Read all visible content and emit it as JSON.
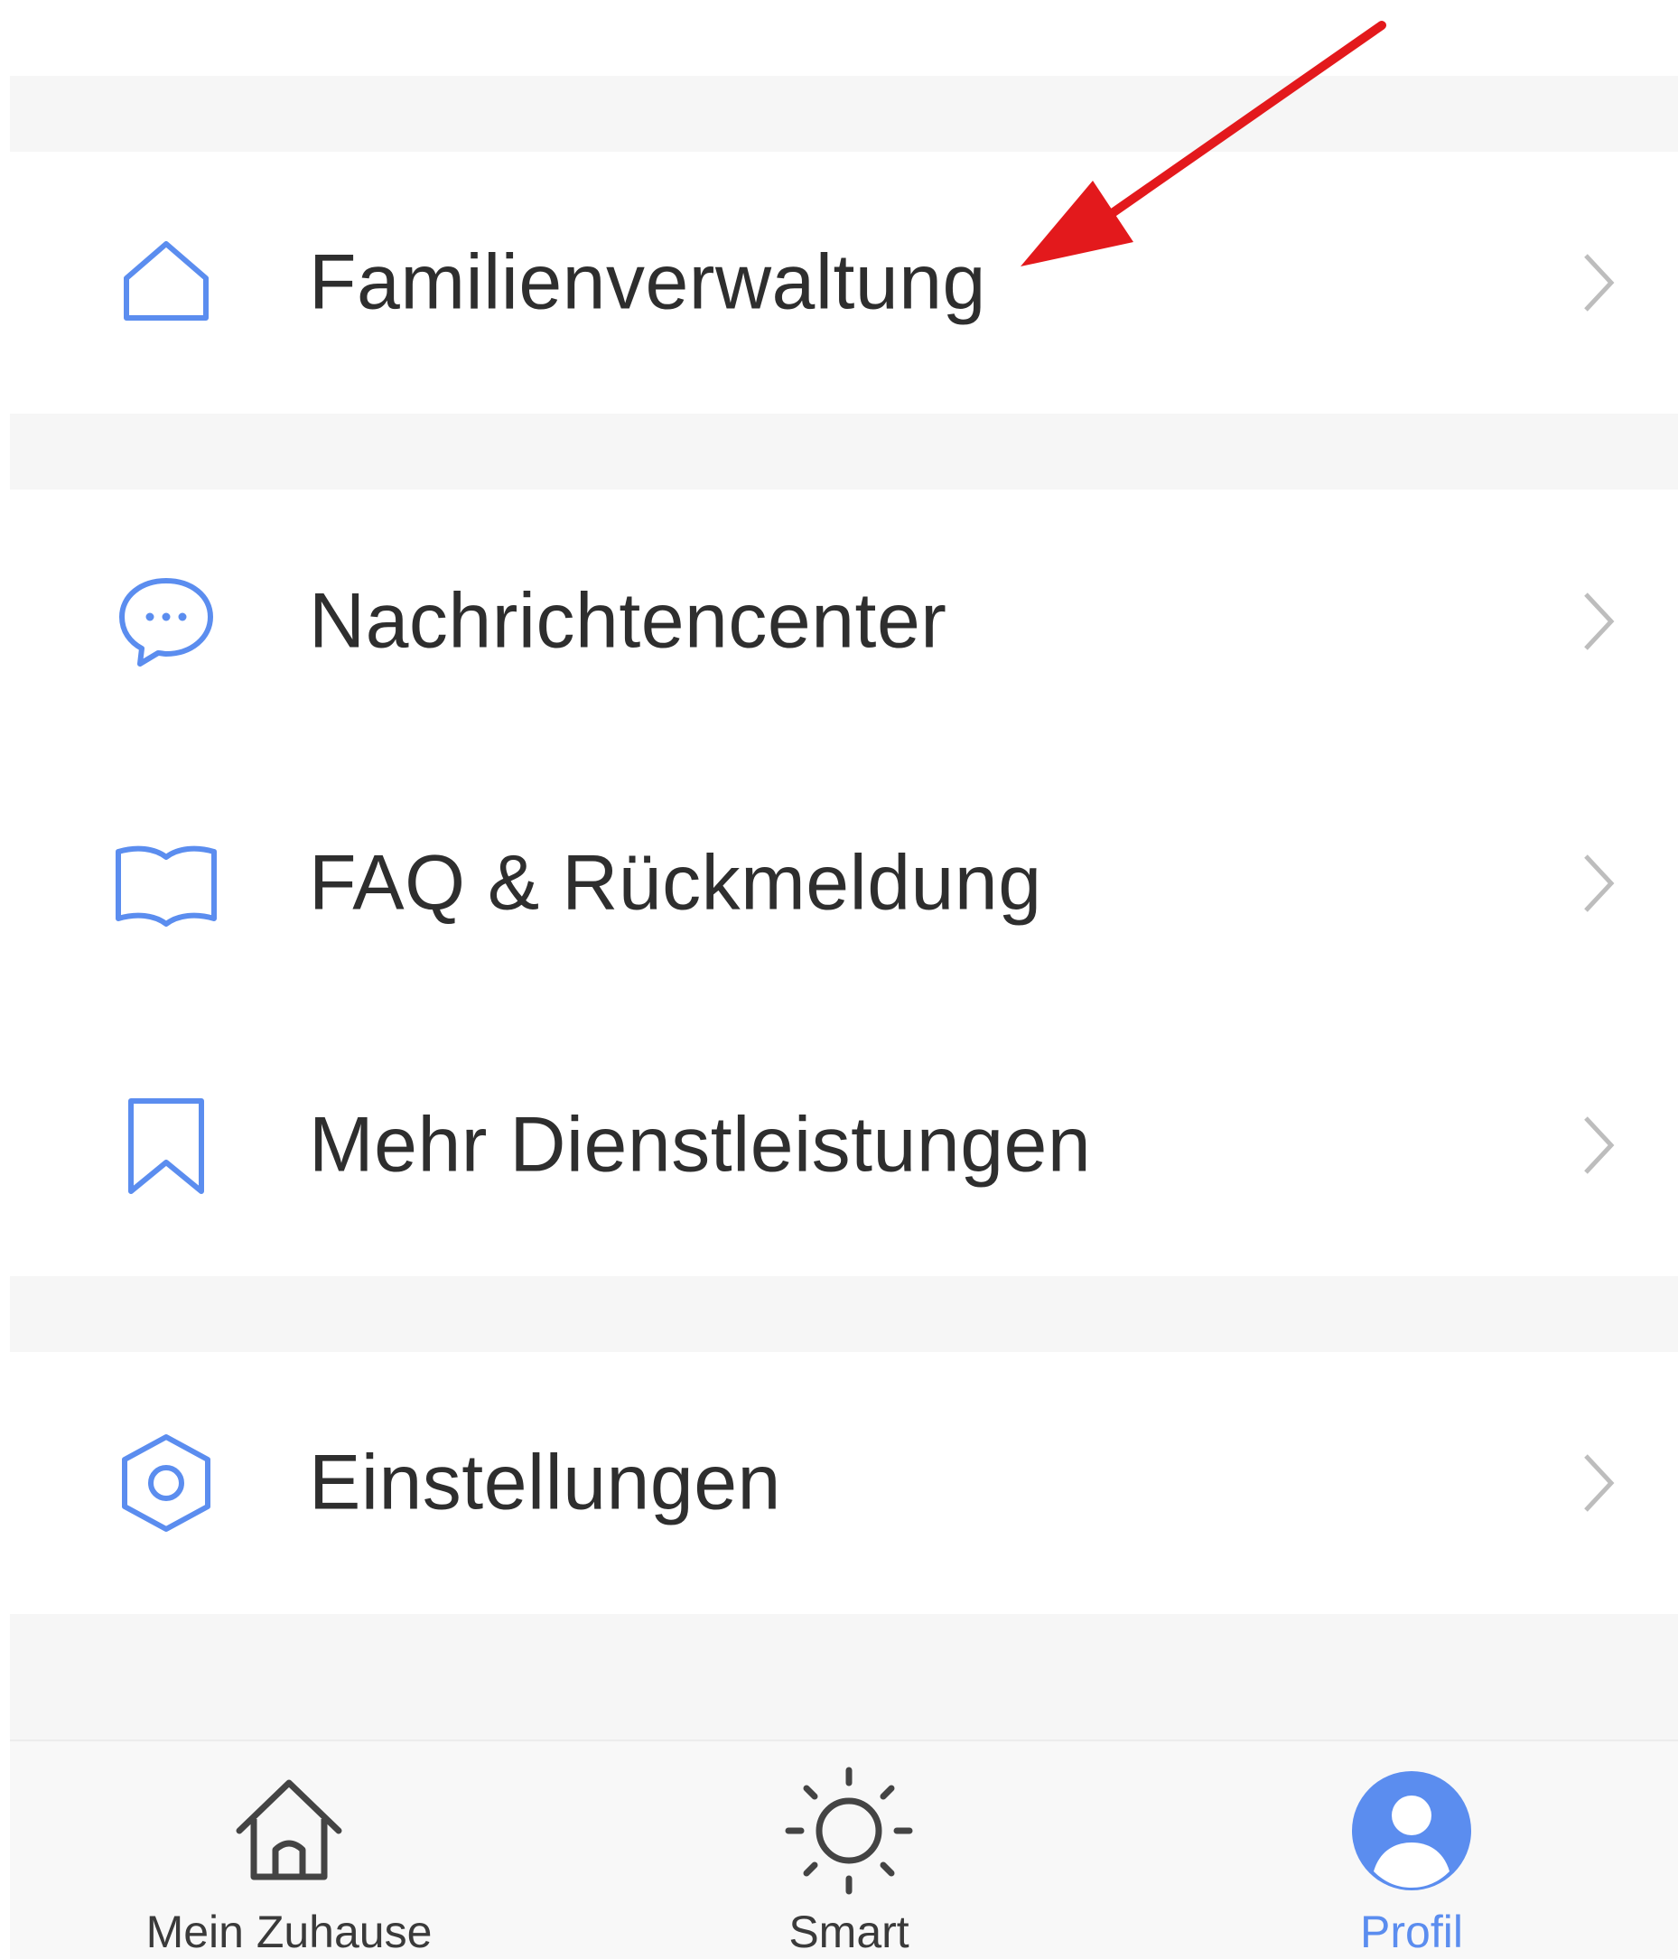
{
  "colors": {
    "accent": "#5b8def",
    "text": "#2e2e2e",
    "chevron": "#bdbdbd",
    "separator": "#f6f6f6",
    "annotation_arrow": "#e3191c"
  },
  "menu": {
    "items": [
      {
        "label": "Familienverwaltung",
        "icon": "home-outline-icon"
      },
      {
        "label": "Nachrichtencenter",
        "icon": "chat-bubble-icon"
      },
      {
        "label": "FAQ & Rückmeldung",
        "icon": "book-open-icon"
      },
      {
        "label": "Mehr Dienstleistungen",
        "icon": "bookmark-icon"
      },
      {
        "label": "Einstellungen",
        "icon": "hexagon-settings-icon"
      }
    ]
  },
  "tabbar": {
    "tabs": [
      {
        "label": "Mein Zuhause",
        "icon": "house-icon",
        "active": false
      },
      {
        "label": "Smart",
        "icon": "sun-icon",
        "active": false
      },
      {
        "label": "Profil",
        "icon": "user-circle-icon",
        "active": true
      }
    ]
  }
}
